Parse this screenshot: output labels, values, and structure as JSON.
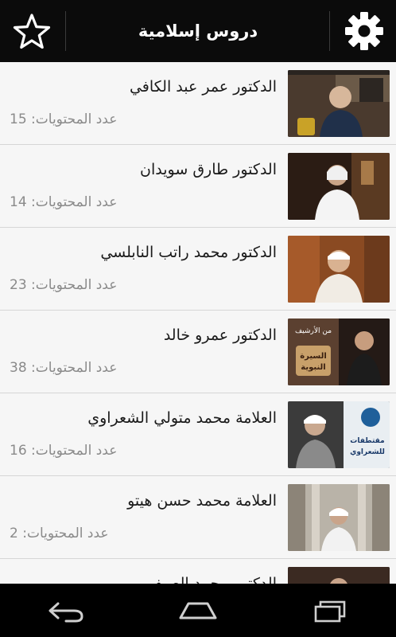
{
  "app": {
    "title": "دروس إسلامية",
    "favorites_icon": "star-outline-icon",
    "settings_icon": "gear-icon"
  },
  "list": {
    "count_label": "عدد المحتويات",
    "items": [
      {
        "name": "الدكتور عمر عبد الكافي",
        "count_text": "عدد المحتويات: 15"
      },
      {
        "name": "الدكتور طارق سويدان",
        "count_text": "عدد المحتويات: 14"
      },
      {
        "name": "الدكتور محمد راتب النابلسي",
        "count_text": "عدد المحتويات: 23"
      },
      {
        "name": "الدكتور عمرو خالد",
        "count_text": "عدد المحتويات: 38",
        "thumb_text": {
          "line1": "من الأرشيف",
          "line2": "السيرة",
          "line3": "النبوية"
        }
      },
      {
        "name": "العلامة محمد متولي الشعراوي",
        "count_text": "عدد المحتويات: 16",
        "thumb_text": {
          "line1": "مقتطفات",
          "line2": "للشعراوي"
        }
      },
      {
        "name": "العلامة محمد حسن هيتو",
        "count_text": "عدد المحتويات: 2"
      },
      {
        "name": "الدكتور محمد الصيفي",
        "count_text": ""
      }
    ]
  },
  "navbar": {
    "back_icon": "back-arrow-icon",
    "home_icon": "home-icon",
    "recents_icon": "recents-icon"
  },
  "colors": {
    "appbar_bg": "#0b0b0b",
    "list_bg": "#f4f4f4",
    "navbar_bg": "#000000",
    "name_text": "#1a1a1a",
    "count_text": "#8a8a8a"
  }
}
